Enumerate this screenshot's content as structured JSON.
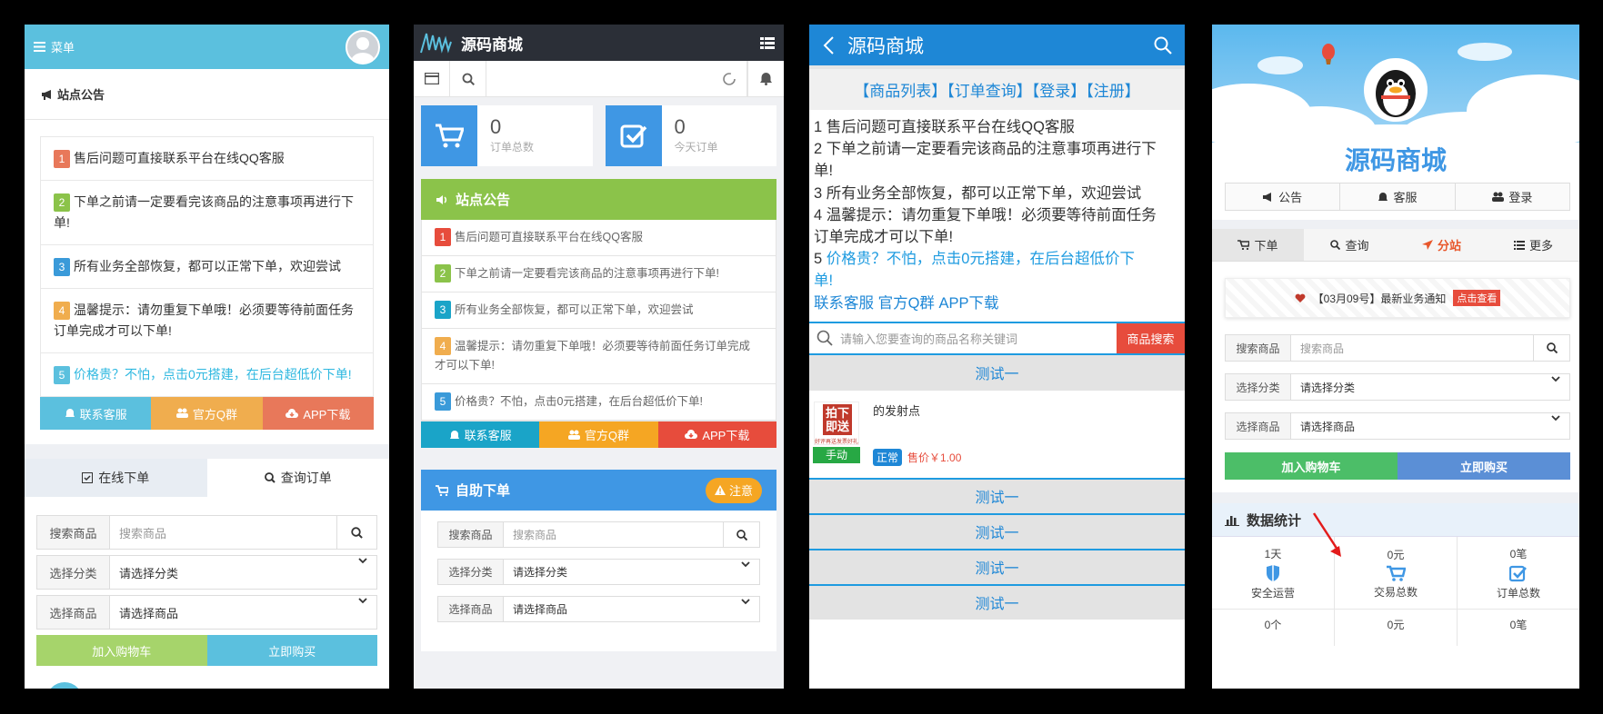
{
  "notices": [
    {
      "n": "1",
      "text": "售后问题可直接联系平台在线QQ客服"
    },
    {
      "n": "2",
      "text": "下单之前请一定要看完该商品的注意事项再进行下单!"
    },
    {
      "n": "3",
      "text": "所有业务全部恢复，都可以正常下单，欢迎尝试"
    },
    {
      "n": "4",
      "text": "温馨提示：请勿重复下单哦！必须要等待前面任务订单完成才可以下单!"
    },
    {
      "n": "5",
      "text": "价格贵？不怕，点击0元搭建，在后台超低价下单!"
    }
  ],
  "p1": {
    "menu": "菜单",
    "notice_title": "站点公告",
    "btn_kefu": "联系客服",
    "btn_qq": "官方Q群",
    "btn_app": "APP下载",
    "tab_order": "在线下单",
    "tab_query": "查询订单",
    "lab_search": "搜索商品",
    "ph_search": "搜索商品",
    "lab_cat": "选择分类",
    "sel_cat": "请选择分类",
    "lab_goods": "选择商品",
    "sel_goods": "请选择商品",
    "btn_cart": "加入购物车",
    "btn_buy": "立即购买"
  },
  "p2": {
    "title": "源码商城",
    "stat1_value": "0",
    "stat1_label": "订单总数",
    "stat2_value": "0",
    "stat2_label": "今天订单",
    "notice_title": "站点公告",
    "notice4_a": "温馨提示：请勿重复下单哦！必须要等待前面任务订单完成",
    "notice4_b": "才可以下单!",
    "btn_kefu": "联系客服",
    "btn_qq": "官方Q群",
    "btn_app": "APP下载",
    "self_title": "自助下单",
    "attention": "注意",
    "lab_search": "搜索商品",
    "ph_search": "搜索商品",
    "lab_cat": "选择分类",
    "sel_cat": "请选择分类",
    "lab_goods": "选择商品",
    "sel_goods": "请选择商品"
  },
  "p3": {
    "title": "源码商城",
    "nav": "【商品列表】【订单查询】【登录】【注册】",
    "lines": [
      "1 售后问题可直接联系平台在线QQ客服",
      "2 下单之前请一定要看完该商品的注意事项再进行下",
      "单!",
      "3 所有业务全部恢复，都可以正常下单，欢迎尝试",
      "4 温馨提示：请勿重复下单哦！必须要等待前面任务",
      "订单完成才可以下单!"
    ],
    "line5_num": "5 ",
    "line5_a": "价格贵？不怕，点击0元搭建，在后台超低价下",
    "line5_b": "单!",
    "links": "联系客服 官方Q群 APP下载",
    "search_ph": "请输入您要查询的商品名称关键词",
    "search_btn": "商品搜索",
    "cat": "测试一",
    "product_name": "的发射点",
    "product_img_text": "拍下即送",
    "product_img_sub": "好评再送发票好礼",
    "manual": "手动",
    "status": "正常",
    "price": "售价￥1.00",
    "cats": [
      "测试一",
      "测试一",
      "测试一",
      "测试一"
    ]
  },
  "p4": {
    "title": "源码商城",
    "btn_notice": "公告",
    "btn_kefu": "客服",
    "btn_login": "登录",
    "tab_order": "下单",
    "tab_query": "查询",
    "tab_sub": "分站",
    "tab_more": "更多",
    "banner": "【03月09号】最新业务通知",
    "banner_btn": "点击查看",
    "lab_search": "搜索商品",
    "ph_search": "搜索商品",
    "lab_cat": "选择分类",
    "sel_cat": "请选择分类",
    "lab_goods": "选择商品",
    "sel_goods": "请选择商品",
    "btn_cart": "加入购物车",
    "btn_buy": "立即购买",
    "stats_title": "数据统计",
    "s1_val": "1天",
    "s1_lab": "安全运营",
    "s2_val": "0元",
    "s2_lab": "交易总数",
    "s3_val": "0笔",
    "s3_lab": "订单总数",
    "r2a": "0个",
    "r2b": "0元",
    "r2c": "0笔"
  },
  "colors": {
    "cyan": "#5bc0de",
    "green": "#8bc34a",
    "blue": "#1e87d6",
    "red": "#e74c3c",
    "orange": "#f0ad4e"
  }
}
